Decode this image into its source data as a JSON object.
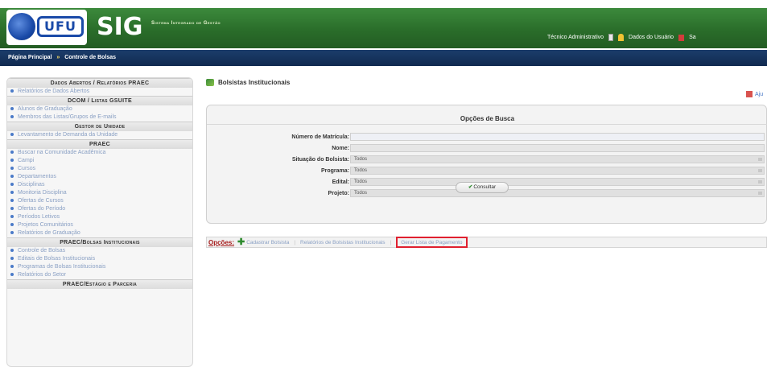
{
  "header": {
    "logo_text": "UFU",
    "app_title": "SIG",
    "app_subtitle": "Sistema Integrado de Gestão",
    "user_role": "Técnico Administrativo",
    "user_data_label": "Dados do Usuário",
    "exit_label": "Sa"
  },
  "nav": {
    "home": "Página Principal",
    "separator": "»",
    "current": "Controle de Bolsas"
  },
  "sidebar": {
    "sections": [
      {
        "title": "Dados Abertos / Relatórios PRAEC",
        "items": [
          "Relatórios de Dados Abertos"
        ]
      },
      {
        "title": "DCOM / Listas GSUITE",
        "items": [
          "Alunos de Graduação",
          "Membros das Listas/Grupos de E-mails"
        ]
      },
      {
        "title": "Gestor de Unidade",
        "items": [
          "Levantamento de Demanda da Unidade"
        ]
      },
      {
        "title": "PRAEC",
        "items": [
          "Buscar na Comunidade Acadêmica",
          "Campi",
          "Cursos",
          "Departamentos",
          "Disciplinas",
          "Monitoria Disciplina",
          "Ofertas de Cursos",
          "Ofertas do Período",
          "Períodos Letivos",
          "Projetos Comunitários",
          "Relatórios de Graduação"
        ]
      },
      {
        "title": "PRAEC/Bolsas Institucionais",
        "items": [
          "Controle de Bolsas",
          "Editais de Bolsas Institucionais",
          "Programas de Bolsas Institucionais",
          "Relatórios do Setor"
        ]
      },
      {
        "title": "PRAEC/Estágio e Parceria",
        "items": []
      }
    ]
  },
  "main": {
    "title": "Bolsistas Institucionais",
    "help_label": "Aju",
    "search_title": "Opções de Busca",
    "fields": [
      {
        "label": "Número de Matrícula:",
        "value": "",
        "kind": "input"
      },
      {
        "label": "Nome:",
        "value": "",
        "kind": "input"
      },
      {
        "label": "Situação do Bolsista:",
        "value": "Todos",
        "kind": "select"
      },
      {
        "label": "Programa:",
        "value": "Todos",
        "kind": "select"
      },
      {
        "label": "Edital:",
        "value": "Todos",
        "kind": "select"
      },
      {
        "label": "Projeto:",
        "value": "Todos",
        "kind": "select"
      }
    ],
    "consult_button": "Consultar",
    "options_label": "Opções:",
    "options": [
      "Cadastrar Bolsista",
      "Relatórios de Bolsistas Institucionais",
      "Gerar Lista de Pagamento"
    ]
  }
}
